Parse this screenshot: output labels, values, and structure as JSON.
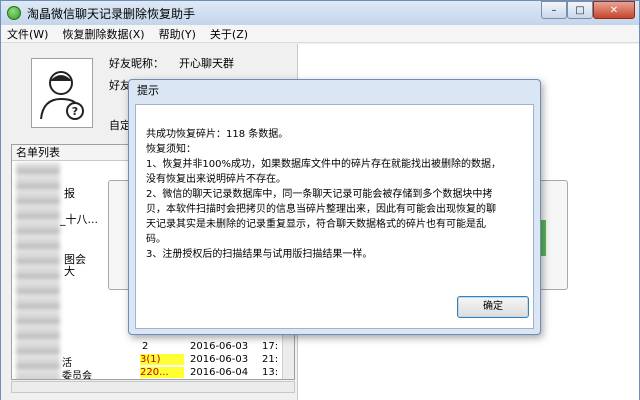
{
  "app": {
    "title": "淘晶微信聊天记录删除恢复助手",
    "icon": "wechat-app-icon"
  },
  "window_controls": {
    "minimize": "–",
    "maximize": "□",
    "close": "✕"
  },
  "menu": [
    "文件(W)",
    "恢复删除数据(X)",
    "帮助(Y)",
    "关于(Z)"
  ],
  "profile": {
    "avatar_icon": "user-unknown-icon",
    "nickname_label": "好友昵称：",
    "nickname_value": "开心聊天群",
    "friend_label_partial": "好友",
    "custom_label_partial": "自定"
  },
  "list": {
    "header": "名单列表",
    "fragments": [
      "报",
      "_十八...",
      "图会",
      "大"
    ],
    "rows": [
      {
        "name": "",
        "count": "2",
        "date": "2016-06-03",
        "time": "17:"
      },
      {
        "name": "活",
        "count": "3(1)",
        "date": "2016-06-03",
        "time": "21:",
        "highlight": true
      },
      {
        "name": "委员会",
        "count": "220...",
        "date": "2016-06-04",
        "time": "13:",
        "highlight": true
      }
    ]
  },
  "dialog": {
    "title": "提示",
    "lines": [
      "共成功恢复碎片：118  条数据。",
      "恢复须知：",
      "1、恢复并非100%成功，如果数据库文件中的碎片存在就能找出被删除的数据，",
      "没有恢复出来说明碎片不存在。",
      "2、微信的聊天记录数据库中，同一条聊天记录可能会被存储到多个数据块中拷",
      "贝，本软件扫描时会把拷贝的信息当碎片整理出来，因此有可能会出现恢复的聊",
      "天记录其实是未删除的记录重复显示，符合聊天数据格式的碎片也有可能是乱",
      "码。",
      "3、注册授权后的扫描结果与试用版扫描结果一样。"
    ],
    "ok_label": "确定"
  },
  "colors": {
    "highlight_bg": "#ffff33",
    "highlight_text": "#c00000",
    "dialog_frame": "#dbe6f4"
  }
}
